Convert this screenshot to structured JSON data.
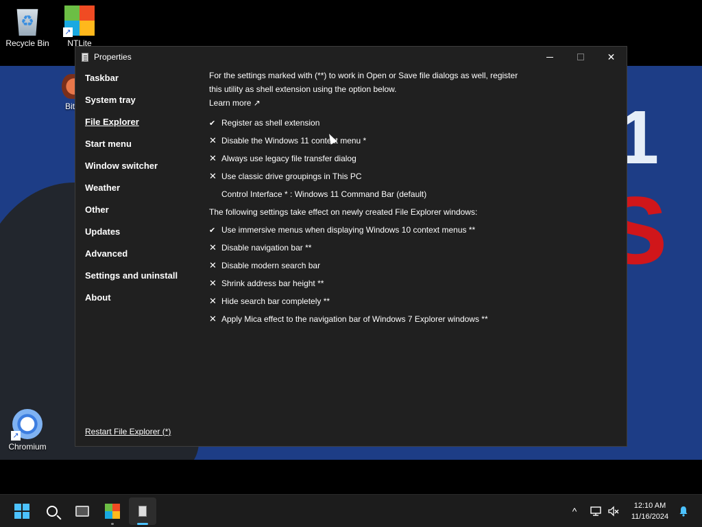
{
  "desktop": {
    "icons": [
      {
        "label": "Recycle Bin",
        "icon": "recycle-bin-icon"
      },
      {
        "label": "NTLite",
        "icon": "ntlite-icon"
      },
      {
        "label": "Chromium",
        "icon": "chromium-icon"
      }
    ],
    "partial_label": "Bit",
    "wallpaper_text_1": "1",
    "wallpaper_text_2": "S"
  },
  "window": {
    "title": "Properties",
    "controls": {
      "minimize": "minimize-icon",
      "maximize": "maximize-icon",
      "close": "close-icon"
    }
  },
  "sidebar": {
    "items": [
      {
        "label": "Taskbar"
      },
      {
        "label": "System tray"
      },
      {
        "label": "File Explorer",
        "selected": true
      },
      {
        "label": "Start menu"
      },
      {
        "label": "Window switcher"
      },
      {
        "label": "Weather"
      },
      {
        "label": "Other"
      },
      {
        "label": "Updates"
      },
      {
        "label": "Advanced"
      },
      {
        "label": "Settings and uninstall"
      },
      {
        "label": "About"
      }
    ],
    "restart_link": "Restart File Explorer (*)"
  },
  "content": {
    "intro": "For the settings marked with (**) to work in Open or Save file dialogs as well, register this utility as shell extension using the option below.",
    "learn_more": "Learn more ↗",
    "options_group_1": [
      {
        "mark": "✔",
        "label": "Register as shell extension"
      },
      {
        "mark": "✕",
        "label": "Disable the Windows 11 context menu *"
      },
      {
        "mark": "✕",
        "label": "Always use legacy file transfer dialog"
      },
      {
        "mark": "✕",
        "label": "Use classic drive groupings in This PC"
      }
    ],
    "control_interface": "Control Interface * : Windows 11 Command Bar (default)",
    "section_label": "The following settings take effect on newly created File Explorer windows:",
    "options_group_2": [
      {
        "mark": "✔",
        "label": "Use immersive menus when displaying Windows 10 context menus **"
      },
      {
        "mark": "✕",
        "label": "Disable navigation bar **"
      },
      {
        "mark": "✕",
        "label": "Disable modern search bar"
      },
      {
        "mark": "✕",
        "label": "Shrink address bar height **"
      },
      {
        "mark": "✕",
        "label": "Hide search bar completely **"
      },
      {
        "mark": "✕",
        "label": "Apply Mica effect to the navigation bar of Windows 7 Explorer windows **"
      }
    ]
  },
  "taskbar": {
    "buttons": [
      "start-icon",
      "search-icon",
      "task-view-icon",
      "ntlite-taskbar-icon",
      "properties-taskbar-icon"
    ],
    "tray": {
      "chevron": "^",
      "time": "12:10 AM",
      "date": "11/16/2024"
    },
    "accent": "#4cc2ff"
  }
}
